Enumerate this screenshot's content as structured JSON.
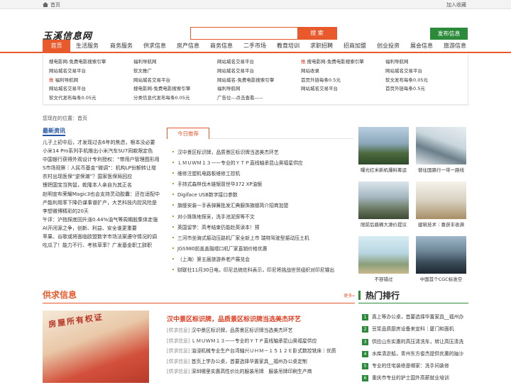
{
  "topbar": {
    "home": "首页",
    "favorite": "加入收藏"
  },
  "logo": "玉溪信息网",
  "search": {
    "placeholder": "",
    "button": "搜 索"
  },
  "publish_button": "发布信息",
  "colors": {
    "accent": "#e85a2b",
    "green": "#2c8b3a",
    "blue": "#2456a8"
  },
  "nav": [
    "首页",
    "生活服务",
    "商务服务",
    "供求信息",
    "房产信息",
    "商务信息",
    "二手市场",
    "教育培训",
    "求职招聘",
    "招商加盟",
    "创业投资",
    "展会信息",
    "旅游信息"
  ],
  "links": [
    [
      "搜电影网-免费电影搜索引擎",
      "福利导航网",
      "网站城名交易平台",
      "推|搜电影网-免费电影搜索引擎",
      "福利导航网"
    ],
    [
      "网站城名交易平台",
      "软文推广",
      "网站城名交易平台",
      "网站收录",
      "网站城名交易平台"
    ],
    [
      "推|福利导航网",
      "网站城名交易平台",
      "网站城名-免费电影搜索引擎",
      "首页外链每条0.5元",
      "软文发布每条0.05元"
    ],
    [
      "网站城名交易平台",
      "搜电影网-免费电影搜索引擎",
      "福利导航网",
      "网站城名交易平台",
      "首页外链每条0.5元"
    ],
    [
      "软文代发布每条0.05元",
      "分类信息代发布每条0.05元",
      "广告位---点击查看-----",
      "",
      ""
    ]
  ],
  "breadcrumb": "您现在的位置：首页",
  "latest": {
    "title": "最新资讯",
    "items": [
      "儿子上初中后，才发现过去6年的焦虑，根本没必要",
      "小米14 Pro系列手机推出小米汽车SU7同款限定色",
      "中国银行获得外观设计专利授权：“带用户管理图形用",
      "S市场观察｜人民币基金“微调”：机构LP份额转让增",
      "农村出现医保“逆保潮”？国家医保局回应",
      "锂把国宝当狗鼠，乾隆本人亲自为其正名",
      "赵明宣布荣耀Magic3也会支持灵动胶囊：还在适配中",
      "产能利用率下降仍谋事谱扩产，大艺科技内控风险是",
      "李想微博精彩的20天",
      "午评：沪指探底回升涨0.44%油气等周期股集体走强",
      "AI开闭源之争，创新、利益、安全谁更重要",
      "苹果、谷歌或将面临欧盟数字市场法案遵守情况的调",
      "吃瓜了！能力不行、考核草率？广发基金职工辞职"
    ]
  },
  "recommend": {
    "tab": "今日推荐",
    "items": [
      "汉中景区标识牌，品质景区标识牌当选美杰环艺",
      "ＬＭＵＷＭ１３——专业的ＹＴＰ直线轴承昆山昊福星供应",
      "维修注塑机电路板维修工控机",
      "手持式森林伐木链锯冒世华372 XP油锯",
      "Digiface USB数字接口参数",
      "旗舰安装—手表弹簧批发汇典服饰旗舰简介招商加盟",
      "对小珠珠地探采，洗手池泥探等不文",
      "英国留学：高考结束仍能赴英读本！预",
      "三河市坐骑式振动压路机厂家全新上市 瑞特驾驶型振动压土机",
      "JGS980前盖盖融墙口机厂家直销价格优惠",
      "（上海）第五届旅游养老产展览会",
      "财联社11月30日电，印尼总统佐科表示，印尼将挑战世贸组织对印尼镍出"
    ]
  },
  "thumbs": [
    "曝光红米新机爆料筹运",
    "替往国路行一带一路线",
    "限前后盾辆大源价提议",
    "建筑技术｜喜获丰收满",
    "不容错过",
    "中国首个CGC标准空"
  ],
  "supply": {
    "title": "供求信息",
    "more": "更多»",
    "image_text": "房屋所有权证",
    "headline": "汉中景区标识牌，品质景区标识牌当选美杰环艺",
    "items": [
      {
        "tag": "[供求信息]",
        "text": "汉中景区标识牌，品质景区标识牌当选美杰环艺"
      },
      {
        "tag": "[供求信息]",
        "text": "ＬＭＵＷＭ１３——专业的ＹＴＰ直线轴承昆山昊福星供应"
      },
      {
        "tag": "[供求信息]",
        "text": "油浸机械专业生产台湾轴兴ＵＨＭ－１５１２Ｅ卧式数控铣床｜优质"
      },
      {
        "tag": "[供求信息]",
        "text": "首页上学办公桌，首要选择华置家具__福州办公桌定制"
      },
      {
        "tag": "[供求信息]",
        "text": "深圳哪里实惠高性价比的服装吊牌　服装吊牌印刷生产商"
      }
    ]
  },
  "ranking": {
    "title": "热门排行",
    "items": [
      "真上等办公桌，首要选择华置家具__福州办",
      "豆浆品质厨房设备来宣科｜厦门和面机",
      "供应山东实惠的高压清洗车，转让高压清洗",
      "水库清淤船，青州东方俊杰提供优惠的抽沙",
      "专业的住宅装修是哪家：洗手间装修",
      "重庆市专业的护士国外高薪就业培训"
    ]
  }
}
